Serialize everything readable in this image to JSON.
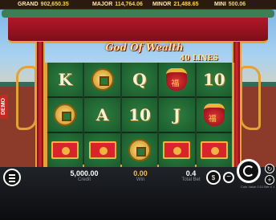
{
  "jackpots": [
    {
      "label": "GRAND",
      "value": "902,650.35"
    },
    {
      "label": "MAJOR",
      "value": "114,764.06"
    },
    {
      "label": "MINOR",
      "value": "21,488.65"
    },
    {
      "label": "MINI",
      "value": "500.06"
    }
  ],
  "game": {
    "title": "God Of Wealth",
    "lines": "40 LINES",
    "demo_badge": "DEMO"
  },
  "reels": [
    [
      "K",
      "coin",
      "envelope"
    ],
    [
      "coin",
      "A",
      "envelope"
    ],
    [
      "Q",
      "10",
      "coin"
    ],
    [
      "bag",
      "J",
      "envelope"
    ],
    [
      "10",
      "bag",
      "envelope"
    ]
  ],
  "bottom": {
    "credit_value": "5,000.00",
    "credit_label": "Credit",
    "win_value": "0.00",
    "win_label": "Win",
    "bet_value": "0.4",
    "bet_label": "Total Bet",
    "coin_info": "Coin Value 0.01  Bet X 1"
  },
  "icons": {
    "menu": "hamburger-icon",
    "coins": "coins-icon",
    "minus": "minus-icon",
    "spin": "spin-icon",
    "auto": "autoplay-icon",
    "plus": "plus-icon"
  }
}
